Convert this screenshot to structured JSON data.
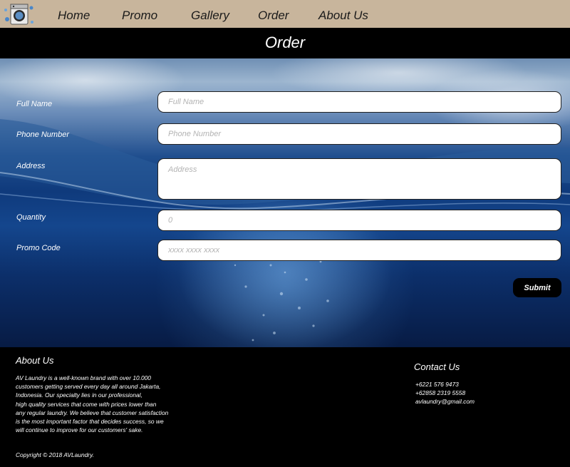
{
  "nav": {
    "logo_icon": "laundry-machine-icon",
    "items": [
      "Home",
      "Promo",
      "Gallery",
      "Order",
      "About Us"
    ]
  },
  "page_title": "Order",
  "form": {
    "fields": [
      {
        "label": "Full Name",
        "placeholder": "Full Name"
      },
      {
        "label": "Phone Number",
        "placeholder": "Phone Number"
      },
      {
        "label": "Address",
        "placeholder": "Address"
      },
      {
        "label": "Quantity",
        "placeholder": "0"
      },
      {
        "label": "Promo Code",
        "placeholder": "xxxx xxxx xxxx"
      }
    ],
    "submit_label": "Submit"
  },
  "footer": {
    "about_heading": "About Us",
    "about_lines": [
      "AV Laundry is a well-known brand with over 10.000",
      "customers getting served every day all around Jakarta,",
      "Indonesia. Our specialty lies in our professional,",
      "high quality services that come with prices lower than",
      "any regular laundry. We believe that customer satisfaction",
      "is the most important factor that decides success, so we",
      "will continue to improve for our customers' sake."
    ],
    "copyright": "Copyright © 2018 AVLaundry.",
    "contact_heading": "Contact Us",
    "contact": {
      "phone1": "+6221 576 9473",
      "phone2": "+62858 2319 5558",
      "email": "avlaundry@gmail.com"
    }
  },
  "colors": {
    "nav_bg": "#c8b59c",
    "bar_bg": "#000000",
    "water_blue": "#0f3a7c"
  }
}
